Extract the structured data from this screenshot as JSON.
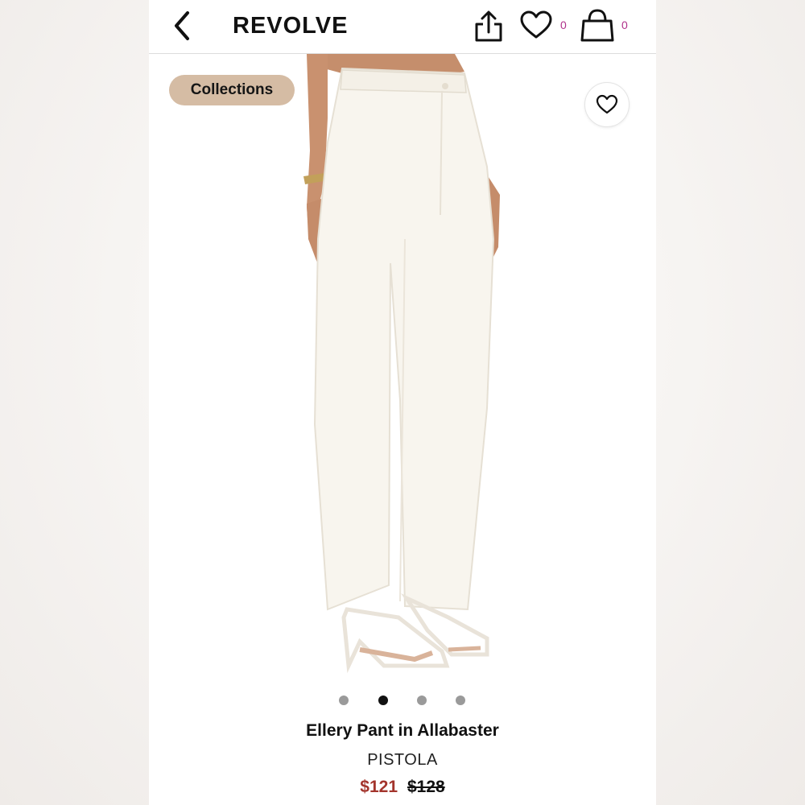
{
  "header": {
    "brand": "REVOLVE",
    "wishlist_count": "0",
    "cart_count": "0",
    "icons": [
      "back-chevron-icon",
      "share-icon",
      "heart-icon",
      "shopping-bag-icon"
    ]
  },
  "gallery": {
    "collections_label": "Collections",
    "current_index": 2,
    "total_images": 4
  },
  "product": {
    "name": "Ellery Pant in Allabaster",
    "designer": "PISTOLA",
    "sale_price": "$121",
    "original_price": "$128"
  },
  "colors": {
    "collections_bg": "#d5bca4",
    "sale_price": "#a3342c",
    "badge_count": "#b0318a"
  }
}
